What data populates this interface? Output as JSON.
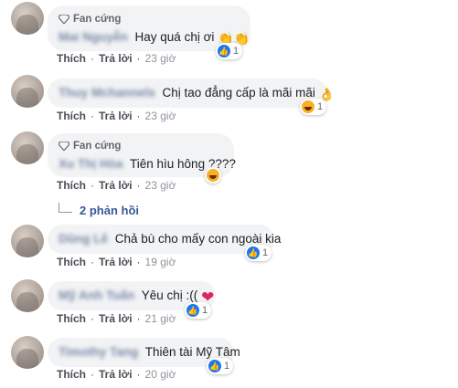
{
  "badge_label": "Fan cứng",
  "actions": {
    "like": "Thích",
    "reply": "Trả lời"
  },
  "comments": [
    {
      "name": "Mai Nguyễn",
      "text": "Hay quá chị ơi",
      "emoji": "👏👏",
      "fan": true,
      "reactions": "1",
      "reaction_type": "like",
      "time": "23 giờ"
    },
    {
      "name": "Thuy Mchannels",
      "text": "Chị tao đẳng cấp là mãi mãi",
      "emoji": "👌",
      "fan": false,
      "reactions": "1",
      "reaction_type": "haha",
      "time": "23 giờ"
    },
    {
      "name": "Xu Thị Hòa",
      "text": "Tiên hìu hông ????",
      "emoji": "",
      "fan": true,
      "reactions": "",
      "reaction_type": "haha",
      "time": "23 giờ",
      "replies": "2 phản hồi"
    },
    {
      "name": "Dũng Lê",
      "text": "Chả bù cho mấy con ngoài kia",
      "emoji": "",
      "fan": false,
      "reactions": "1",
      "reaction_type": "like",
      "time": "19 giờ"
    },
    {
      "name": "Mỹ Anh Tuấn",
      "text": "Yêu chị :((",
      "emoji": "❤",
      "fan": false,
      "reactions": "1",
      "reaction_type": "like",
      "time": "21 giờ"
    },
    {
      "name": "Timothy Tang",
      "text": "Thiên tài Mỹ Tâm",
      "emoji": "",
      "fan": false,
      "reactions": "1",
      "reaction_type": "like",
      "time": "20 giờ"
    }
  ],
  "colors": {
    "link": "#385898",
    "bubble": "#f2f3f5",
    "like": "#1877f2",
    "haha": "#f7b125"
  }
}
